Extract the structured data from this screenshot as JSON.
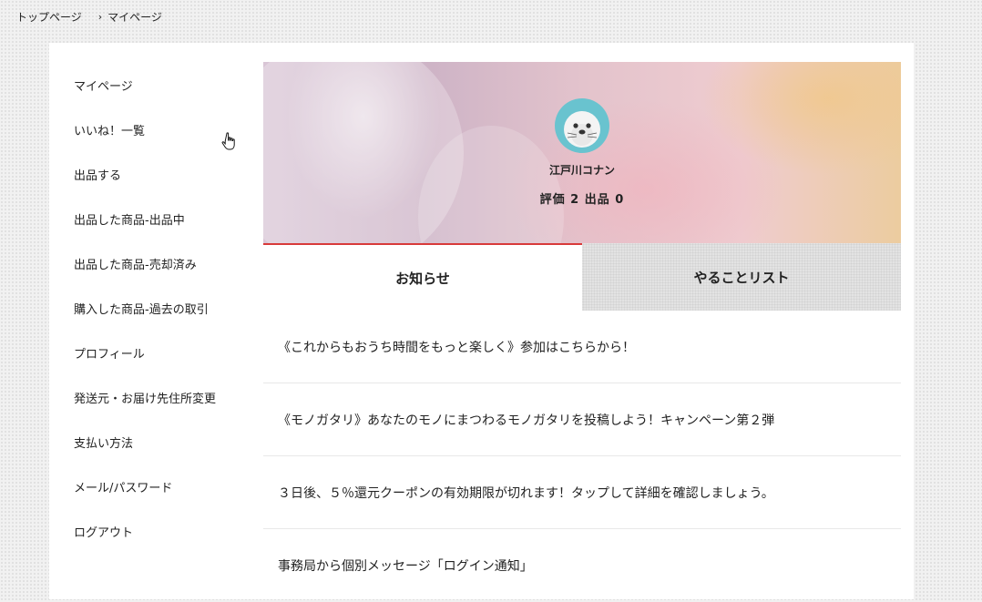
{
  "breadcrumb": {
    "home": "トップページ",
    "separator": "›",
    "current": "マイページ"
  },
  "sidebar": {
    "items": [
      {
        "label": "マイページ"
      },
      {
        "label": "いいね！一覧"
      },
      {
        "label": "出品する"
      },
      {
        "label": "出品した商品-出品中"
      },
      {
        "label": "出品した商品-売却済み"
      },
      {
        "label": "購入した商品-過去の取引"
      },
      {
        "label": "プロフィール"
      },
      {
        "label": "発送元・お届け先住所変更"
      },
      {
        "label": "支払い方法"
      },
      {
        "label": "メール/パスワード"
      },
      {
        "label": "ログアウト"
      }
    ]
  },
  "profile": {
    "avatar_icon": "seal-icon",
    "name": "江戸川コナン",
    "stats": "評価 2 出品 0"
  },
  "tabs": {
    "notice_label": "お知らせ",
    "todo_label": "やることリスト",
    "active_color": "#d83a3a"
  },
  "news": [
    {
      "text": "《これからもおうち時間をもっと楽しく》参加はこちらから！"
    },
    {
      "text": "《モノガタリ》あなたのモノにまつわるモノガタリを投稿しよう！キャンペーン第２弾"
    },
    {
      "text": "３日後、５％還元クーポンの有効期限が切れます！タップして詳細を確認しましょう。"
    },
    {
      "text": "事務局から個別メッセージ「ログイン通知」"
    }
  ]
}
